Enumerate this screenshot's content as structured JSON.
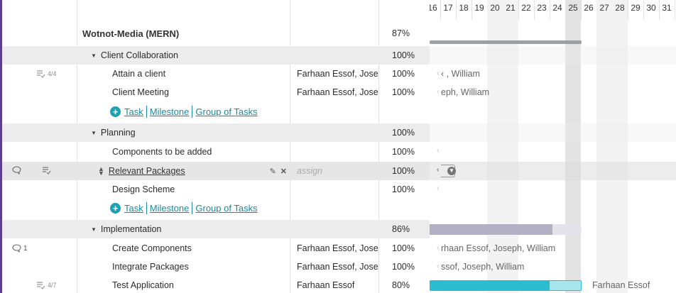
{
  "project": {
    "title": "Wotnot-Media (MERN)",
    "percent": "87%"
  },
  "sections": [
    {
      "name": "Client Collaboration",
      "percent": "100%",
      "tasks": [
        {
          "name": "Attain a client",
          "assignees": "Farhaan Essof, Jose",
          "percent": "100%",
          "subtasks": "4/4",
          "gantt_label": "‹ , William"
        },
        {
          "name": "Client Meeting",
          "assignees": "Farhaan Essof, Jose",
          "percent": "100%",
          "gantt_label": "eph, William"
        }
      ]
    },
    {
      "name": "Planning",
      "percent": "100%",
      "tasks": [
        {
          "name": "Components to be added",
          "assignees": "",
          "percent": "100%"
        },
        {
          "name": "Relevant Packages",
          "assignees": "assign",
          "percent": "100%"
        },
        {
          "name": "Design Scheme",
          "assignees": "",
          "percent": "100%"
        }
      ]
    },
    {
      "name": "Implementation",
      "percent": "86%",
      "tasks": [
        {
          "name": "Create Components",
          "assignees": "Farhaan Essof, Jose",
          "percent": "100%",
          "comments": "1",
          "gantt_label": "rhaan Essof, Joseph, William"
        },
        {
          "name": "Integrate Packages",
          "assignees": "Farhaan Essof, Jose",
          "percent": "100%",
          "gantt_label": "ssof, Joseph, William"
        },
        {
          "name": "Test Application",
          "assignees": "Farhaan Essof",
          "percent": "80%",
          "subtasks": "4/7",
          "gantt_label": "Farhaan Essof"
        }
      ]
    }
  ],
  "add_links": {
    "task": "Task",
    "milestone": "Milestone",
    "group": "Group of Tasks"
  },
  "gantt": {
    "days": [
      "16",
      "17",
      "18",
      "19",
      "20",
      "21",
      "22",
      "23",
      "24",
      "25",
      "26",
      "27",
      "28",
      "29",
      "30",
      "31"
    ],
    "today": "25",
    "weekend_days": [
      "20",
      "21",
      "27",
      "28"
    ]
  },
  "progress": {
    "project": 1.0,
    "implementation": 0.86,
    "test_application": 0.8
  },
  "colors": {
    "accent": "#1ba3b5",
    "link": "#1a8aa0",
    "summary_bar": "#9aa0a8",
    "group_bar": "#b3b0c4",
    "task_bar": "#2bbcd0",
    "task_bar_light": "#a8e6ee"
  },
  "icons": {
    "comment": "comment-icon",
    "subtasks": "checklist-icon",
    "drag": "drag-handle-icon",
    "edit": "pencil-icon",
    "delete": "close-icon",
    "collapse": "caret-down-icon",
    "add": "plus-circle-icon"
  }
}
